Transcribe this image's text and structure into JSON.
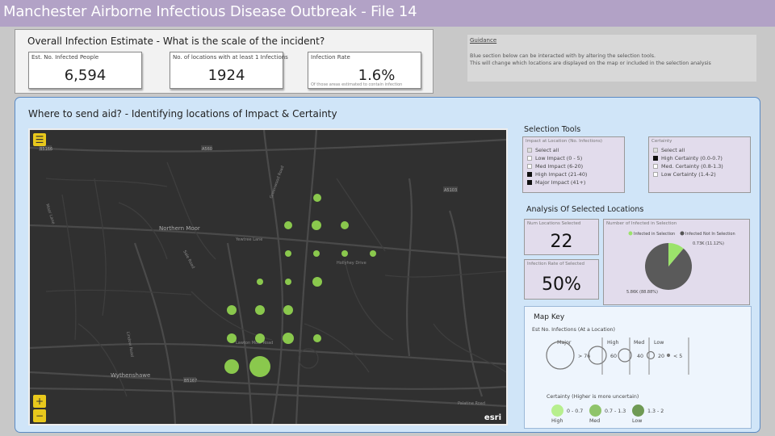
{
  "title": "Manchester Airborne Infectious Disease Outbreak - File 14",
  "overall": {
    "heading": "Overall Infection Estimate - What is the scale of the incident?",
    "cards": [
      {
        "label": "Est. No. Infected People",
        "value": "6,594"
      },
      {
        "label": "No. of locations with at least 1 Infections",
        "value": "1924"
      },
      {
        "label": "Infection Rate",
        "value": "1.6%",
        "sub": "Of those areas estimated to contain infection"
      }
    ]
  },
  "guidance": {
    "title": "Guidance",
    "line1": "Blue section below can be interacted with by altering the selection tools.",
    "line2": "This will change which locations are displayed on the map or included in the selection analysis"
  },
  "aid": {
    "heading": "Where to send aid? - Identifying locations of Impact & Certainty"
  },
  "map": {
    "menu_icon": "hamburger-icon",
    "zoom_in": "+",
    "zoom_out": "−",
    "attribution": "esri",
    "places": {
      "northern_moor": "Northern Moor",
      "wythenshawe": "Wythenshawe"
    },
    "streets": {
      "yewtree_lane": "Yewtree Lane",
      "lawton_moor": "Lawton Moor Road",
      "hollyhey": "Hollyhey Drive",
      "sale_road": "Sale Road",
      "moor_lane": "Moor Lane",
      "greenwood": "Greenwood Road",
      "lindow": "Lindow Road",
      "palatine": "Palatine Road"
    },
    "roads": {
      "b5166": "B5166",
      "a560": "A560",
      "b5167": "B5167",
      "a5103": "A5103"
    }
  },
  "selection_tools": {
    "title": "Selection Tools",
    "impact": {
      "title": "Impact at Location (No. Infections)",
      "options": [
        {
          "label": "Select all",
          "state": "partial"
        },
        {
          "label": "Low Impact (0 - 5)",
          "state": "off"
        },
        {
          "label": "Med Impact (6-20)",
          "state": "off"
        },
        {
          "label": "High Impact (21-40)",
          "state": "on"
        },
        {
          "label": "Major Impact (41+)",
          "state": "on"
        }
      ]
    },
    "certainty": {
      "title": "Certainty",
      "options": [
        {
          "label": "Select all",
          "state": "partial"
        },
        {
          "label": "High Certainty (0.0-0.7)",
          "state": "on"
        },
        {
          "label": "Med. Certainty (0.8-1.3)",
          "state": "off"
        },
        {
          "label": "Low Certainty (1.4-2)",
          "state": "off"
        }
      ]
    }
  },
  "analysis": {
    "title": "Analysis Of Selected Locations",
    "num_locations": {
      "label": "Num Locations Selected",
      "value": "22"
    },
    "infection_rate": {
      "label": "Infection Rate of Selected",
      "value": "50%"
    },
    "pie": {
      "label": "Number of Infected in Selection",
      "legend_in": "Infected in Selection",
      "legend_out": "Infected Not In Selection",
      "slice_in_label": "0.73K (11.12%)",
      "slice_out_label": "5.86K (88.88%)",
      "slice_in_share": 0.1112,
      "color_in": "#9be36b",
      "color_out": "#5a5a5a"
    }
  },
  "map_key": {
    "title": "Map Key",
    "size_title": "Est No. Infections (At a Location)",
    "major": "Major",
    "high": "High",
    "med": "Med",
    "low": "Low",
    "v_major": "> 76",
    "v_60": "60",
    "v_40": "40",
    "v_20": "20",
    "v_low": "< 5",
    "certainty_title": "Certainty (Higher is more uncertain)",
    "c1": "0 - 0.7",
    "c2": "0.7 - 1.3",
    "c3": "1.3 - 2",
    "c1_lbl": "High",
    "c2_lbl": "Med",
    "c3_lbl": "Low",
    "c1_color": "#b7ef8e",
    "c2_color": "#8fc46a",
    "c3_color": "#6f9a54"
  }
}
